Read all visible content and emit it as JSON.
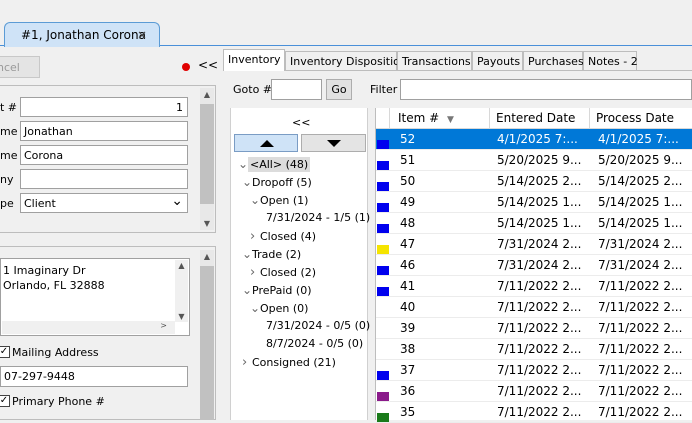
{
  "doc_tab": {
    "title": "#1, Jonathan Corona",
    "close": "×"
  },
  "left": {
    "cancel_label": "ncel",
    "collapse_label": "<<",
    "fields": [
      {
        "label": "t #",
        "value": "1"
      },
      {
        "label": "me",
        "value": "Jonathan"
      },
      {
        "label": "me",
        "value": "Corona"
      },
      {
        "label": "ny",
        "value": ""
      },
      {
        "label": "pe",
        "value": "Client"
      }
    ],
    "address_lines": [
      "1 Imaginary Dr",
      "Orlando, FL  32888"
    ],
    "mailing_label": "Mailing Address",
    "mailing_checked": "✓",
    "phone_value": "07-297-9448",
    "primary_phone_label": "Primary Phone #",
    "primary_phone_checked": "✓"
  },
  "tabs": [
    "Inventory",
    "Inventory Disposition",
    "Transactions",
    "Payouts",
    "Purchases",
    "Notes - 2"
  ],
  "toolbar": {
    "goto_label": "Goto #",
    "go_label": "Go",
    "filter_label": "Filter",
    "collapse_label": "<<"
  },
  "tree": [
    {
      "text": "<All> (48)",
      "level": 0,
      "chev": "v",
      "selected": true
    },
    {
      "text": "Dropoff (5)",
      "level": 1,
      "chev": "v"
    },
    {
      "text": "Open (1)",
      "level": 2,
      "chev": "v"
    },
    {
      "text": "7/31/2024 - 1/5 (1)",
      "level": 3,
      "chev": ""
    },
    {
      "text": "Closed (4)",
      "level": 2,
      "chev": ">"
    },
    {
      "text": "Trade (2)",
      "level": 1,
      "chev": "v"
    },
    {
      "text": "Closed (2)",
      "level": 2,
      "chev": ">"
    },
    {
      "text": "PrePaid (0)",
      "level": 1,
      "chev": "v"
    },
    {
      "text": "Open (0)",
      "level": 2,
      "chev": "v"
    },
    {
      "text": "7/31/2024 - 0/5 (0)",
      "level": 3,
      "chev": ""
    },
    {
      "text": "8/7/2024 - 0/5 (0)",
      "level": 3,
      "chev": ""
    },
    {
      "text": "Consigned (21)",
      "level": 1,
      "chev": ">"
    }
  ],
  "grid": {
    "columns": [
      "Item #",
      "Entered Date",
      "Process Date"
    ],
    "sort_indicator": "▼",
    "rows": [
      {
        "item": "52",
        "entered": "4/1/2025 7:...",
        "process": "4/1/2025 7:...",
        "color": "#0000ee",
        "selected": true
      },
      {
        "item": "51",
        "entered": "5/20/2025 9...",
        "process": "5/20/2025 9...",
        "color": "#0000ee"
      },
      {
        "item": "50",
        "entered": "5/14/2025 2...",
        "process": "5/14/2025 2...",
        "color": "#0000ee"
      },
      {
        "item": "49",
        "entered": "5/14/2025 1...",
        "process": "5/14/2025 1...",
        "color": "#0000ee"
      },
      {
        "item": "48",
        "entered": "5/14/2025 1...",
        "process": "5/14/2025 1...",
        "color": "#0000ee"
      },
      {
        "item": "47",
        "entered": "7/31/2024 2...",
        "process": "7/31/2024 2...",
        "color": "#f5e400"
      },
      {
        "item": "46",
        "entered": "7/31/2024 2...",
        "process": "7/31/2024 2...",
        "color": "#0000ee"
      },
      {
        "item": "41",
        "entered": "7/11/2022 2...",
        "process": "7/11/2022 2...",
        "color": "#0000ee"
      },
      {
        "item": "40",
        "entered": "7/11/2022 2...",
        "process": "7/11/2022 2...",
        "color": ""
      },
      {
        "item": "39",
        "entered": "7/11/2022 2...",
        "process": "7/11/2022 2...",
        "color": ""
      },
      {
        "item": "38",
        "entered": "7/11/2022 2...",
        "process": "7/11/2022 2...",
        "color": ""
      },
      {
        "item": "37",
        "entered": "7/11/2022 2...",
        "process": "7/11/2022 2...",
        "color": "#0000ee"
      },
      {
        "item": "36",
        "entered": "7/11/2022 2...",
        "process": "7/11/2022 2...",
        "color": "#8a1a8a"
      },
      {
        "item": "35",
        "entered": "7/11/2022 2...",
        "process": "7/11/2022 2...",
        "color": "#1a7a1a"
      }
    ]
  }
}
